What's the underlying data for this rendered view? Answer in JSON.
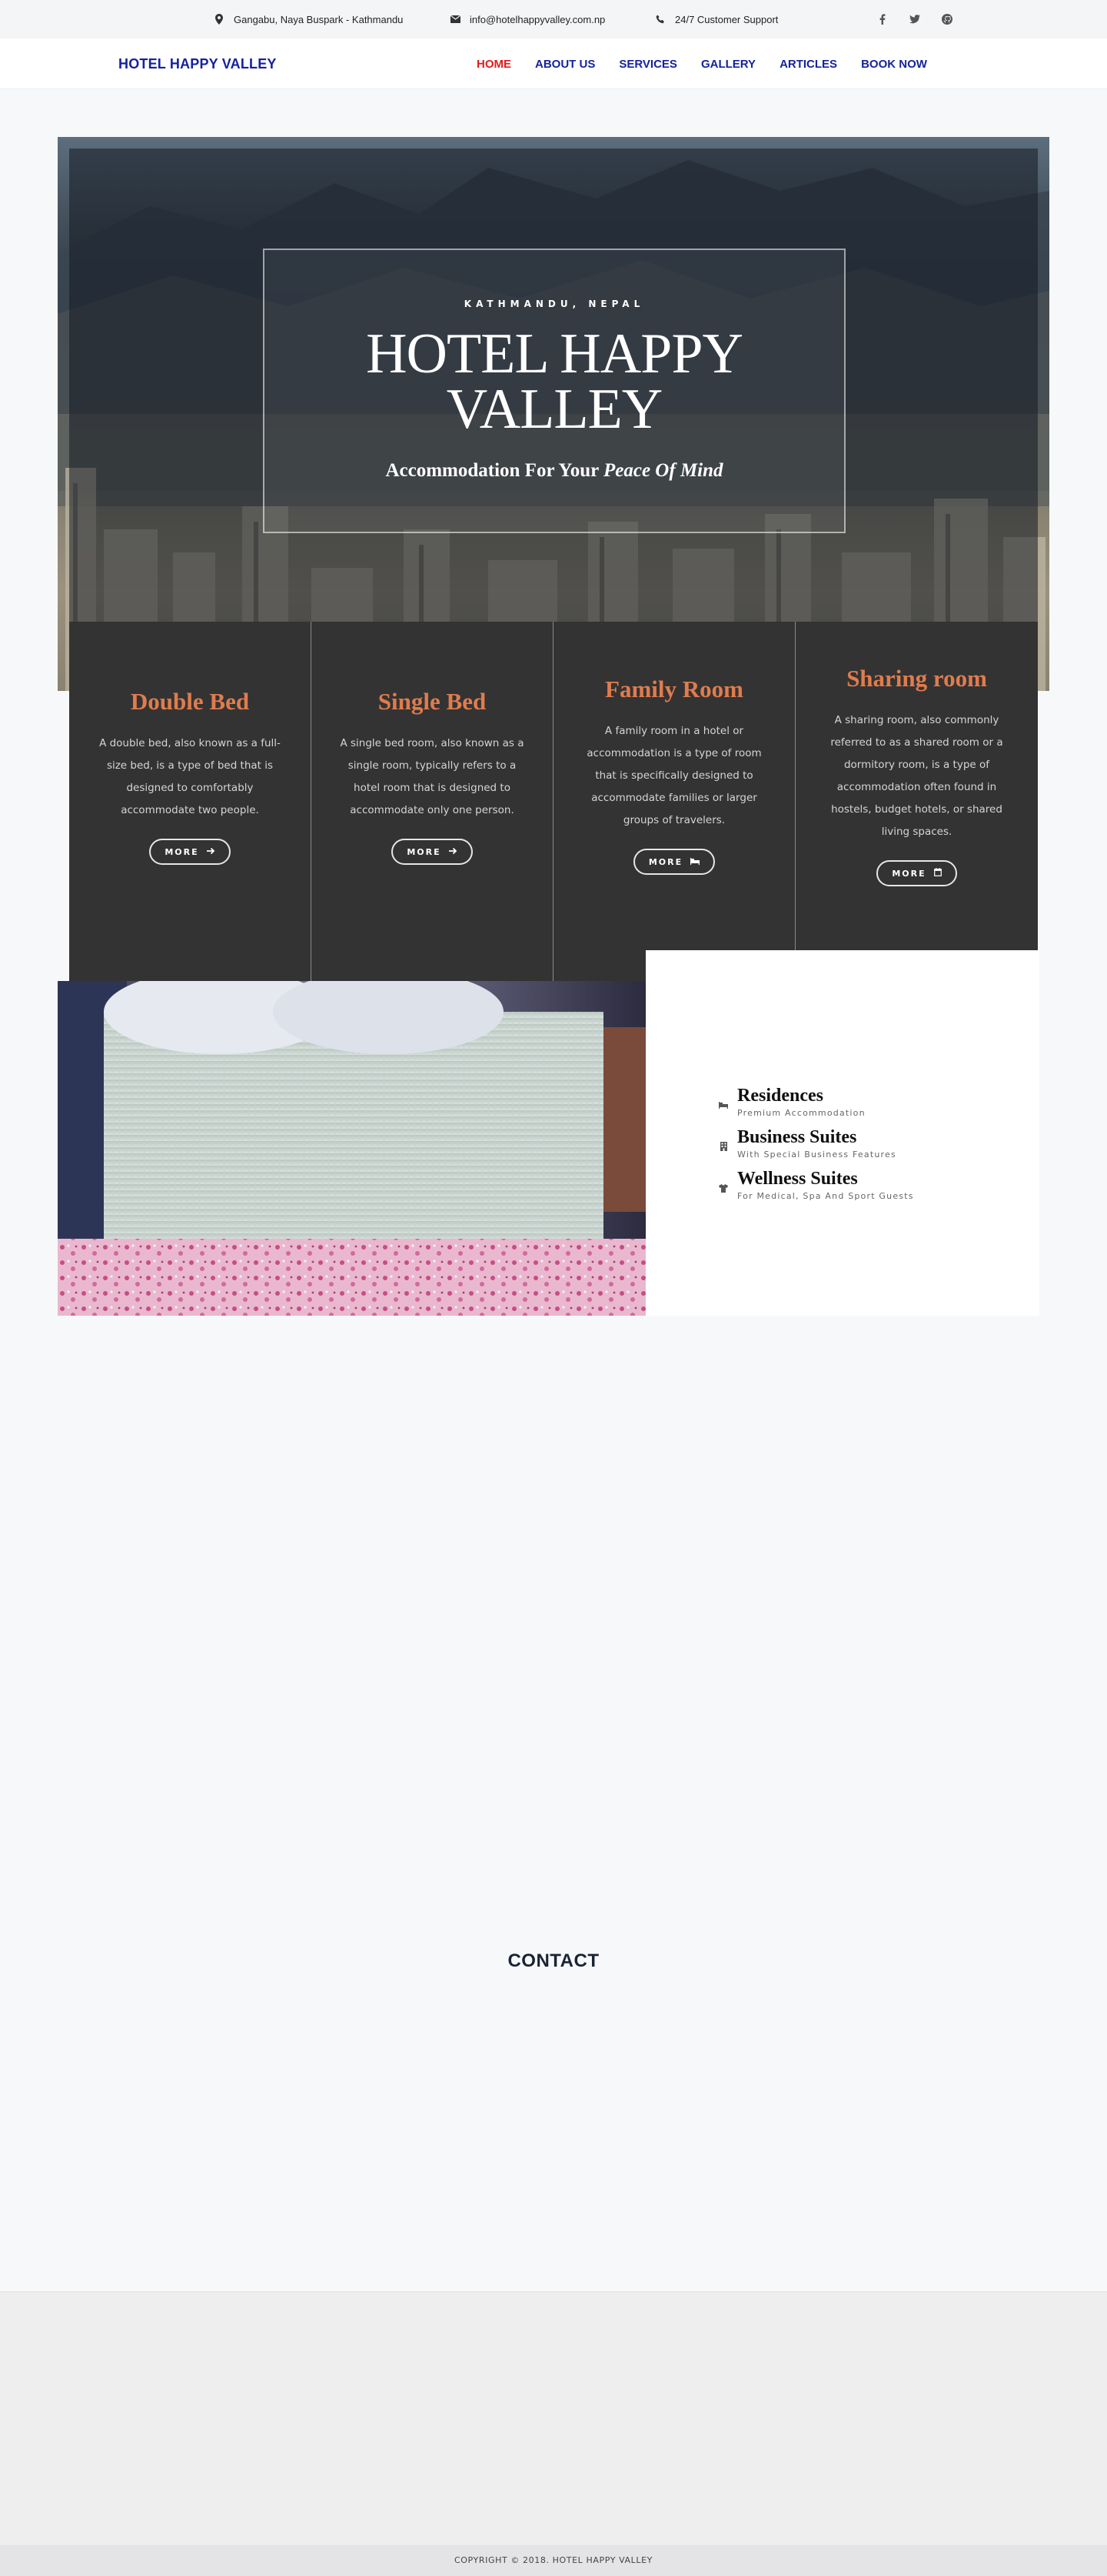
{
  "topbar": {
    "address": "Gangabu, Naya Buspark - Kathmandu",
    "address_icon": "map-marker-icon",
    "email": "info@hotelhappyvalley.com.np",
    "email_icon": "envelope-icon",
    "support": "24/7 Customer Support",
    "support_icon": "phone-icon",
    "social": [
      "facebook-icon",
      "twitter-icon",
      "github-icon"
    ]
  },
  "nav": {
    "brand": "HOTEL HAPPY VALLEY",
    "links": [
      "HOME",
      "ABOUT US",
      "SERVICES",
      "GALLERY",
      "ARTICLES",
      "BOOK NOW"
    ],
    "active_index": 0,
    "active_color": "#e11b1b",
    "link_color": "#14239c"
  },
  "hero": {
    "kicker": "KATHMANDU, NEPAL",
    "title_line1": "HOTEL HAPPY",
    "title_line2": "VALLEY",
    "tagline_prefix": "Accommodation For Your",
    "tagline_italic": "Peace Of Mind"
  },
  "rooms": [
    {
      "title": "Double Bed",
      "desc": "A double bed, also known as a full-size bed, is a type of bed that is designed to comfortably accommodate two people.",
      "button": "MORE",
      "button_icon": "arrow-right-icon"
    },
    {
      "title": "Single Bed",
      "desc": "A single bed room, also known as a single room, typically refers to a hotel room that is designed to accommodate only one person.",
      "button": "MORE",
      "button_icon": "arrow-right-icon"
    },
    {
      "title": "Family Room",
      "desc": "A family room in a hotel or accommodation is a type of room that is specifically designed to accommodate families or larger groups of travelers.",
      "button": "MORE",
      "button_icon": "bed-icon"
    },
    {
      "title": "Sharing room",
      "desc": "A sharing room, also commonly referred to as a shared room or a dormitory room, is a type of accommodation often found in hostels, budget hotels, or shared living spaces.",
      "button": "MORE",
      "button_icon": "calendar-icon"
    }
  ],
  "room_accent": "#e07c4d",
  "suites": [
    {
      "title": "Residences",
      "sub": "Premium Accommodation",
      "icon": "bed-icon"
    },
    {
      "title": "Business Suites",
      "sub": "With Special Business Features",
      "icon": "building-icon"
    },
    {
      "title": "Wellness Suites",
      "sub": "For Medical, Spa And Sport Guests",
      "icon": "shirt-icon"
    }
  ],
  "contact": {
    "title": "CONTACT"
  },
  "footer": {
    "copyright": "COPYRIGHT © 2018. HOTEL HAPPY VALLEY"
  }
}
